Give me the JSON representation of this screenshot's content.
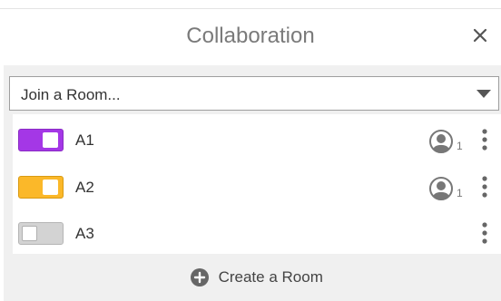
{
  "header": {
    "title": "Collaboration",
    "close_icon": "close-icon"
  },
  "room_select": {
    "value": "Join a Room...",
    "caret_icon": "caret-down-icon"
  },
  "rooms": [
    {
      "name": "A1",
      "enabled": true,
      "color": "#a437e6",
      "users": "1",
      "user_icon": "user-icon",
      "menu_icon": "more-vertical-icon"
    },
    {
      "name": "A2",
      "enabled": true,
      "color": "#fbb829",
      "users": "1",
      "user_icon": "user-icon",
      "menu_icon": "more-vertical-icon"
    },
    {
      "name": "A3",
      "enabled": false,
      "color": "#d3d3d3",
      "users": "",
      "menu_icon": "more-vertical-icon"
    }
  ],
  "create_room": {
    "label": "Create a Room",
    "icon": "plus-circle-icon"
  }
}
